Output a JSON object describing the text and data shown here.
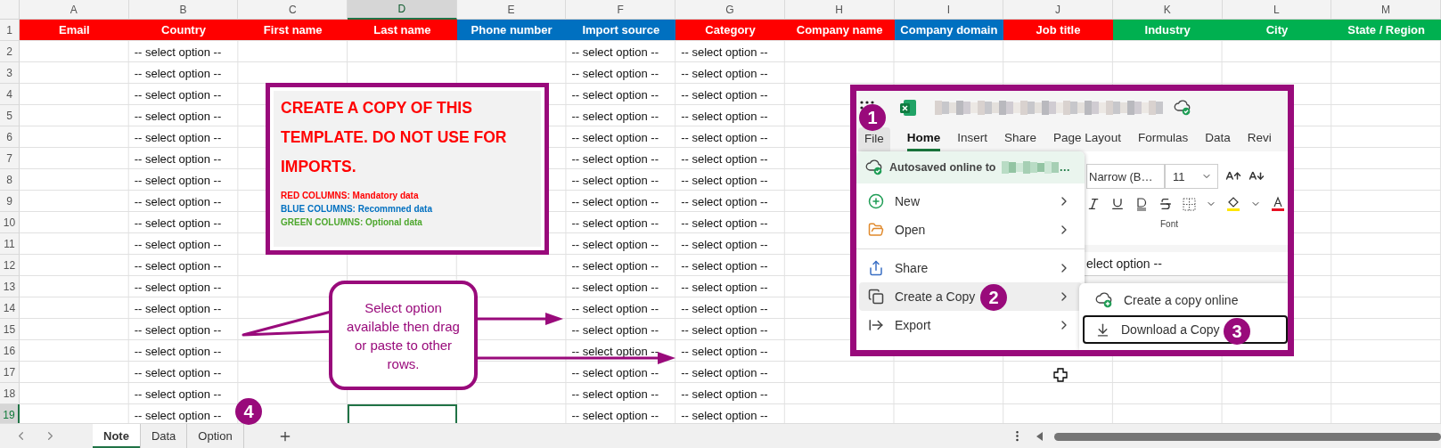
{
  "sheet": {
    "columns": [
      {
        "letter": "A",
        "selected": false
      },
      {
        "letter": "B",
        "selected": false
      },
      {
        "letter": "C",
        "selected": false
      },
      {
        "letter": "D",
        "selected": true
      },
      {
        "letter": "E",
        "selected": false
      },
      {
        "letter": "F",
        "selected": false
      },
      {
        "letter": "G",
        "selected": false
      },
      {
        "letter": "H",
        "selected": false
      },
      {
        "letter": "I",
        "selected": false
      },
      {
        "letter": "J",
        "selected": false
      },
      {
        "letter": "K",
        "selected": false
      },
      {
        "letter": "L",
        "selected": false
      },
      {
        "letter": "M",
        "selected": false
      }
    ],
    "header_row": {
      "number": "1",
      "cells": [
        {
          "label": "Email",
          "color": "#ff0000"
        },
        {
          "label": "Country",
          "color": "#ff0000"
        },
        {
          "label": "First name",
          "color": "#ff0000"
        },
        {
          "label": "Last name",
          "color": "#ff0000"
        },
        {
          "label": "Phone number",
          "color": "#0070c0"
        },
        {
          "label": "Import source",
          "color": "#0070c0"
        },
        {
          "label": "Category",
          "color": "#ff0000"
        },
        {
          "label": "Company name",
          "color": "#ff0000"
        },
        {
          "label": "Company domain",
          "color": "#0070c0"
        },
        {
          "label": "Job title",
          "color": "#ff0000"
        },
        {
          "label": "Industry",
          "color": "#00b050"
        },
        {
          "label": "City",
          "color": "#00b050"
        },
        {
          "label": "State / Region",
          "color": "#00b050"
        }
      ]
    },
    "rows": [
      {
        "number": "2",
        "selected": false,
        "cells": {
          "B": "-- select option --",
          "F": "-- select option --",
          "G": "-- select option --"
        }
      },
      {
        "number": "3",
        "selected": false,
        "cells": {
          "B": "-- select option --",
          "F": "-- select option --",
          "G": "-- select option --"
        }
      },
      {
        "number": "4",
        "selected": false,
        "cells": {
          "B": "-- select option --",
          "F": "-- select option --",
          "G": "-- select option --"
        }
      },
      {
        "number": "5",
        "selected": false,
        "cells": {
          "B": "-- select option --",
          "F": "-- select option --",
          "G": "-- select option --"
        }
      },
      {
        "number": "6",
        "selected": false,
        "cells": {
          "B": "-- select option --",
          "F": "-- select option --",
          "G": "-- select option --"
        }
      },
      {
        "number": "7",
        "selected": false,
        "cells": {
          "B": "-- select option --",
          "F": "-- select option --",
          "G": "-- select option --"
        }
      },
      {
        "number": "8",
        "selected": false,
        "cells": {
          "B": "-- select option --",
          "F": "-- select option --",
          "G": "-- select option --"
        }
      },
      {
        "number": "9",
        "selected": false,
        "cells": {
          "B": "-- select option --",
          "F": "-- select option --",
          "G": "-- select option --"
        }
      },
      {
        "number": "10",
        "selected": false,
        "cells": {
          "B": "-- select option --",
          "F": "-- select option --",
          "G": "-- select option --"
        }
      },
      {
        "number": "11",
        "selected": false,
        "cells": {
          "B": "-- select option --",
          "F": "-- select option --",
          "G": "-- select option --"
        }
      },
      {
        "number": "12",
        "selected": false,
        "cells": {
          "B": "-- select option --",
          "F": "-- select option --",
          "G": "-- select option --"
        }
      },
      {
        "number": "13",
        "selected": false,
        "cells": {
          "B": "-- select option --",
          "F": "-- select option --",
          "G": "-- select option --"
        }
      },
      {
        "number": "14",
        "selected": false,
        "cells": {
          "B": "-- select option --",
          "F": "-- select option --",
          "G": "-- select option --"
        }
      },
      {
        "number": "15",
        "selected": false,
        "cells": {
          "B": "-- select option --",
          "F": "-- select option --",
          "G": "-- select option --"
        }
      },
      {
        "number": "16",
        "selected": false,
        "cells": {
          "B": "-- select option --",
          "F": "-- select option --",
          "G": "-- select option --"
        }
      },
      {
        "number": "17",
        "selected": false,
        "cells": {
          "B": "-- select option --",
          "F": "-- select option --",
          "G": "-- select option --"
        }
      },
      {
        "number": "18",
        "selected": false,
        "cells": {
          "B": "-- select option --",
          "F": "-- select option --",
          "G": "-- select option --"
        }
      },
      {
        "number": "19",
        "selected": true,
        "cells": {
          "B": "-- select option --",
          "F": "-- select option --",
          "G": "-- select option --"
        }
      }
    ]
  },
  "note": {
    "title": "CREATE A COPY OF THIS TEMPLATE. DO NOT USE FOR IMPORTS.",
    "legend": [
      {
        "text": "RED COLUMNS: Mandatory data",
        "color": "#ff0000"
      },
      {
        "text": "BLUE COLUMNS: Recommned data",
        "color": "#0070c0"
      },
      {
        "text": "GREEN COLUMNS: Optional data",
        "color": "#4ea72e"
      }
    ]
  },
  "callout": {
    "text": "Select option available then drag or paste to other rows."
  },
  "inset": {
    "file_tab": {
      "label": "File",
      "open": true
    },
    "ribbon_tabs": [
      {
        "label": "Home",
        "selected": true
      },
      {
        "label": "Insert",
        "selected": false
      },
      {
        "label": "Share",
        "selected": false
      },
      {
        "label": "Page Layout",
        "selected": false
      },
      {
        "label": "Formulas",
        "selected": false
      },
      {
        "label": "Data",
        "selected": false
      },
      {
        "label": "Revi",
        "selected": false
      }
    ],
    "font_name": "Narrow (B…",
    "font_size": "11",
    "group_label": "Font",
    "formula_text": "elect option --",
    "file_menu": {
      "autosave": "Autosaved online to",
      "autosave_ellipsis": "…",
      "items": [
        {
          "label": "New",
          "selected": false
        },
        {
          "label": "Open",
          "selected": false
        },
        {
          "label": "Share",
          "selected": false
        },
        {
          "label": "Create a Copy",
          "selected": true
        },
        {
          "label": "Export",
          "selected": false
        }
      ]
    },
    "submenu": [
      {
        "label": "Create a copy online",
        "selected": false
      },
      {
        "label": "Download a Copy",
        "selected": true
      }
    ]
  },
  "steps": [
    {
      "number": "1"
    },
    {
      "number": "2"
    },
    {
      "number": "3"
    },
    {
      "number": "4"
    }
  ],
  "sheet_tabs": [
    {
      "label": "Note",
      "selected": true
    },
    {
      "label": "Data",
      "selected": false
    },
    {
      "label": "Option",
      "selected": false
    }
  ]
}
